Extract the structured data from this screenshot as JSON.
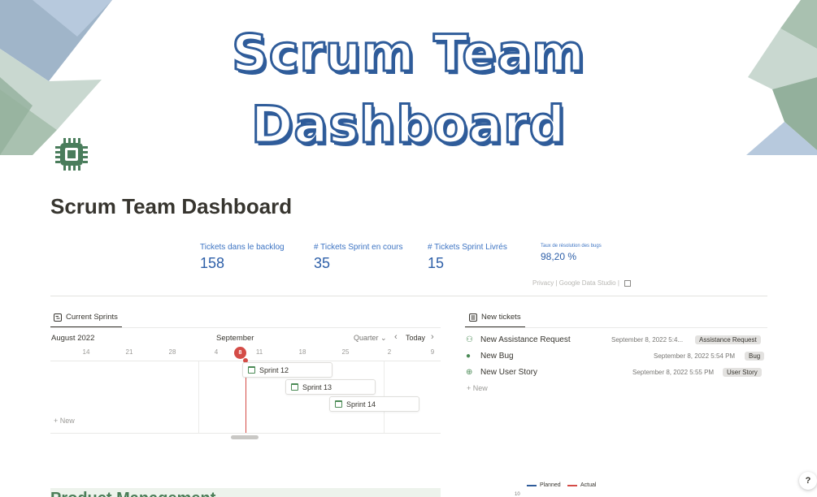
{
  "cover": {
    "title_line1": "Scrum Team",
    "title_line2": "Dashboard"
  },
  "page": {
    "title": "Scrum Team Dashboard",
    "icon": "cpu-chip-icon"
  },
  "stats": [
    {
      "label": "Tickets dans le backlog",
      "value": "158"
    },
    {
      "label": "# Tickets Sprint en cours",
      "value": "35"
    },
    {
      "label": "# Tickets Sprint Livrés",
      "value": "15"
    },
    {
      "label": "Taux de résolution des bugs",
      "value": "98,20 %"
    }
  ],
  "embed_footer": {
    "privacy": "Privacy",
    "separator": "|",
    "provider": "Google Data Studio"
  },
  "views": {
    "sprints_tab": "Current Sprints",
    "tickets_tab": "New tickets"
  },
  "timeline": {
    "month_left": "August 2022",
    "month_mid": "September",
    "scale": "Quarter",
    "today_label": "Today",
    "days": [
      "14",
      "21",
      "28",
      "4",
      "11",
      "18",
      "25",
      "2",
      "9"
    ],
    "today_day": "8",
    "sprints": [
      "Sprint 12",
      "Sprint 13",
      "Sprint 14"
    ],
    "new_label": "New"
  },
  "tickets": {
    "rows": [
      {
        "name": "New Assistance Request",
        "date": "September 8, 2022 5:4...",
        "tag": "Assistance Request"
      },
      {
        "name": "New Bug",
        "date": "September 8, 2022 5:54 PM",
        "tag": "Bug"
      },
      {
        "name": "New User Story",
        "date": "September 8, 2022 5:55 PM",
        "tag": "User Story"
      }
    ],
    "new_label": "New"
  },
  "bottom": {
    "section_title": "Product Management",
    "legend": [
      {
        "name": "Planned",
        "color": "#2f5c9a"
      },
      {
        "name": "Actual",
        "color": "#d44c47"
      }
    ],
    "axis_tick": "10"
  },
  "help": "?"
}
